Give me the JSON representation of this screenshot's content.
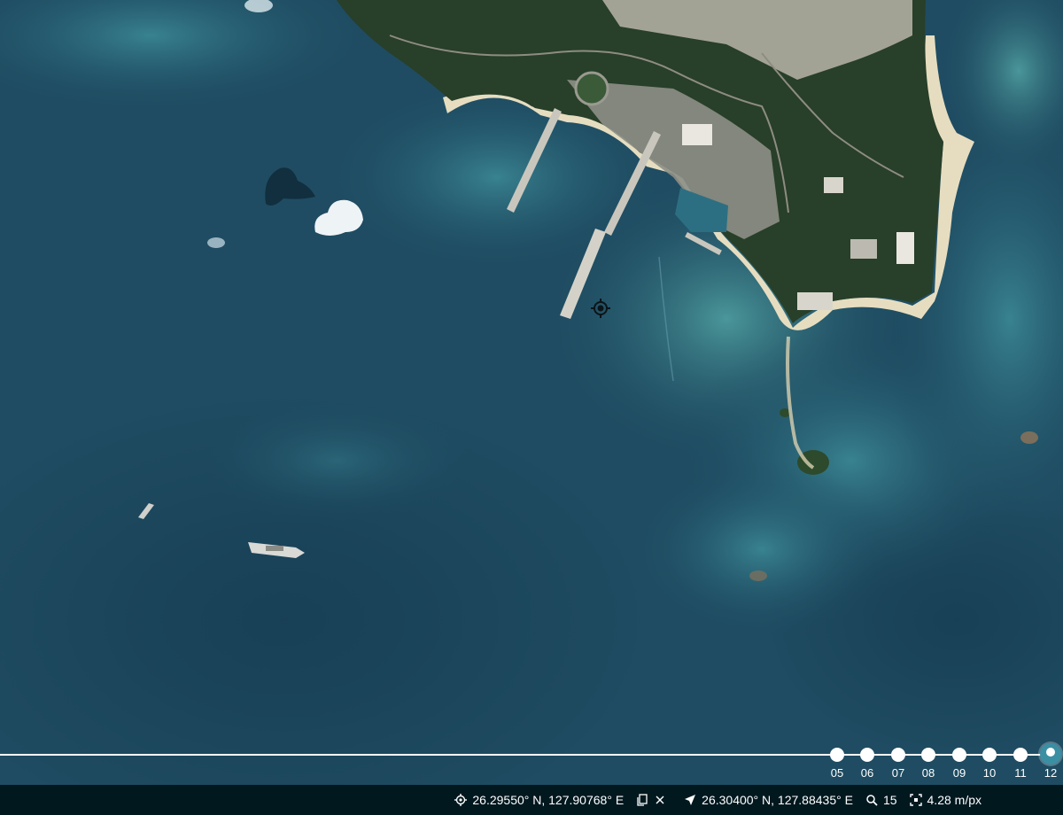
{
  "map": {
    "sea_color": "#1d4a60",
    "land_color": "#263f28",
    "beach_color": "#e7dfc4"
  },
  "timeline": {
    "labels": [
      "05",
      "06",
      "07",
      "08",
      "09",
      "10",
      "11",
      "12"
    ],
    "selected": "12",
    "accent_color": "#3b8fa3"
  },
  "status": {
    "cursor_coords": "26.29550° N, 127.90768° E",
    "location_coords": "26.30400° N, 127.88435° E",
    "zoom": "15",
    "resolution": "4.28 m/px",
    "icons": [
      "crosshair-icon",
      "copy-icon",
      "close-icon",
      "location-arrow-icon",
      "zoom-icon",
      "resolution-icon"
    ]
  }
}
